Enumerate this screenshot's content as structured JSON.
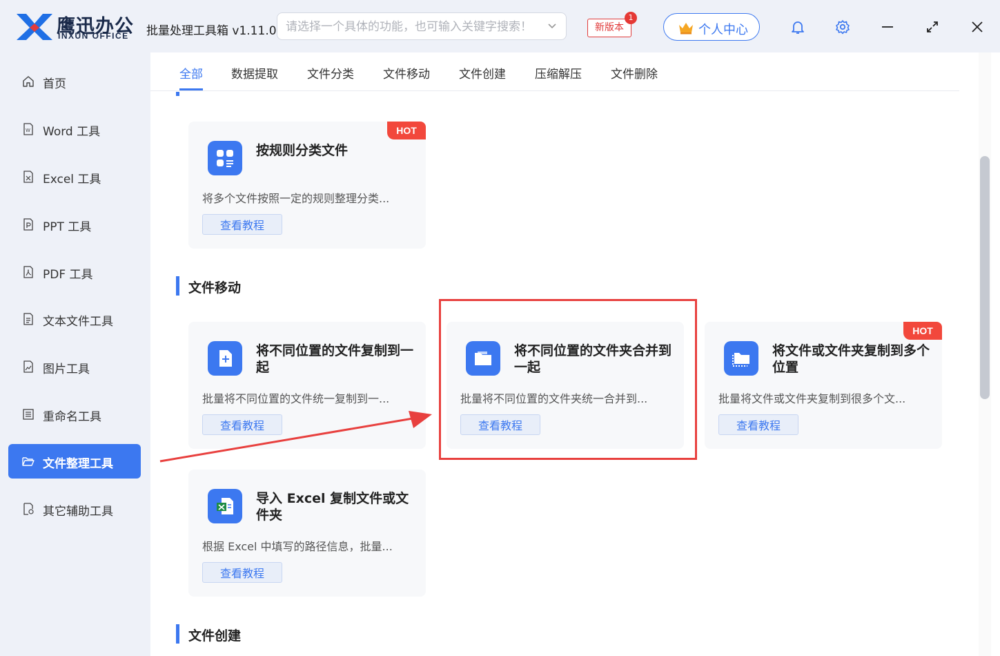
{
  "app": {
    "logo_cn": "鹰迅办公",
    "logo_en": "INXUN OFFICE",
    "title": "批量处理工具箱 v1.11.0"
  },
  "search": {
    "placeholder": "请选择一个具体的功能，也可输入关键字搜索！"
  },
  "header": {
    "new_version": "新版本",
    "new_version_count": "1",
    "user_center": "个人中心"
  },
  "sidebar": {
    "items": [
      {
        "label": "首页"
      },
      {
        "label": "Word 工具"
      },
      {
        "label": "Excel 工具"
      },
      {
        "label": "PPT 工具"
      },
      {
        "label": "PDF 工具"
      },
      {
        "label": "文本文件工具"
      },
      {
        "label": "图片工具"
      },
      {
        "label": "重命名工具"
      },
      {
        "label": "文件整理工具"
      },
      {
        "label": "其它辅助工具"
      }
    ],
    "active_index": 8
  },
  "tabs": [
    "全部",
    "数据提取",
    "文件分类",
    "文件移动",
    "文件创建",
    "压缩解压",
    "文件删除"
  ],
  "sections": {
    "move": "文件移动",
    "create": "文件创建"
  },
  "cards": [
    {
      "title": "按规则分类文件",
      "desc": "将多个文件按照一定的规则整理分类...",
      "button": "查看教程",
      "badge": "HOT"
    },
    {
      "title": "将不同位置的文件复制到一起",
      "desc": "批量将不同位置的文件统一复制到一...",
      "button": "查看教程"
    },
    {
      "title": "将不同位置的文件夹合并到一起",
      "desc": "批量将不同位置的文件夹统一合并到...",
      "button": "查看教程"
    },
    {
      "title": "将文件或文件夹复制到多个位置",
      "desc": "批量将文件或文件夹复制到很多个文...",
      "button": "查看教程",
      "badge": "HOT"
    },
    {
      "title": "导入 Excel 复制文件或文件夹",
      "desc": "根据 Excel 中填写的路径信息，批量...",
      "button": "查看教程"
    }
  ],
  "colors": {
    "accent": "#3c78f0",
    "highlight": "#e8403e",
    "hot": "#f2483c"
  }
}
